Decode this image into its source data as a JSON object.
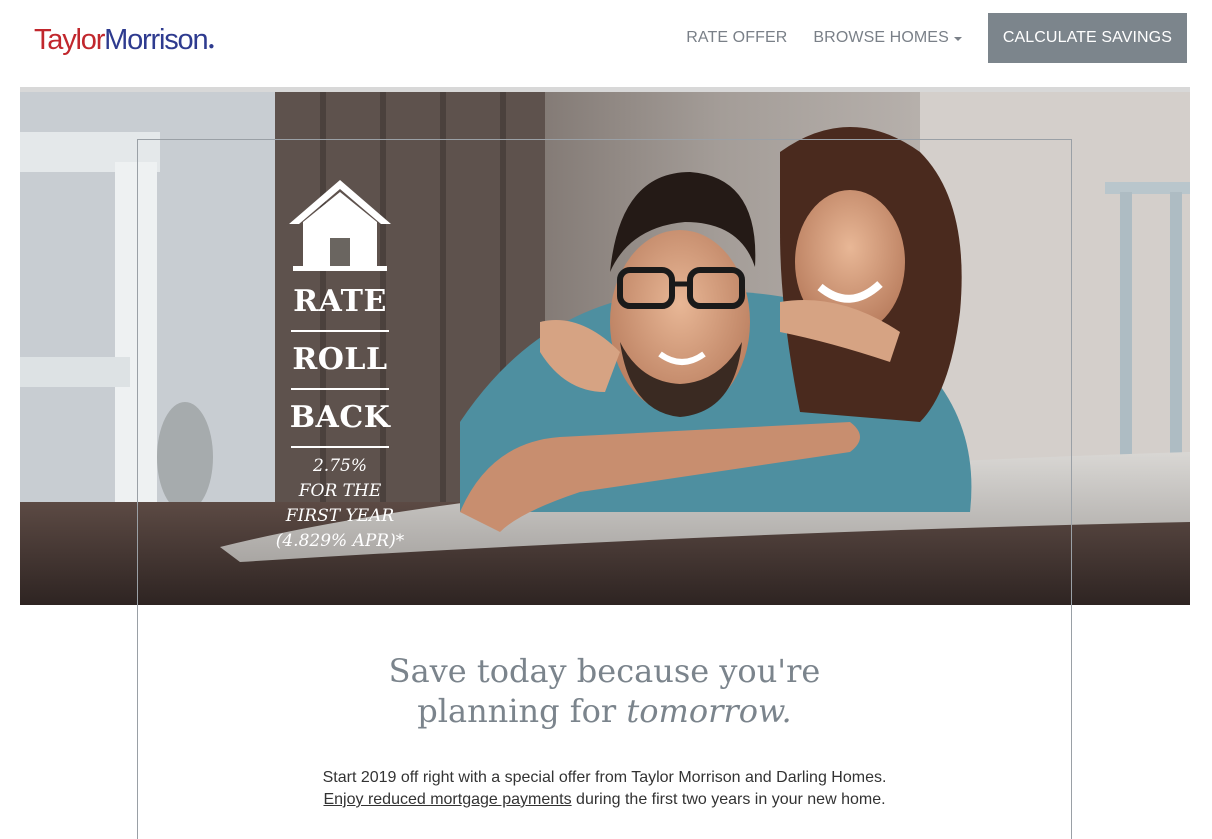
{
  "header": {
    "logo_taylor": "Taylor",
    "logo_morrison": "Morrison",
    "logo_dot": "●",
    "nav": {
      "rate_offer": "RATE OFFER",
      "browse_homes": "BROWSE HOMES",
      "calculate_savings": "CALCULATE SAVINGS"
    }
  },
  "hero": {
    "badge": {
      "line1": "RATE",
      "line2": "ROLL",
      "line3": "BACK",
      "rate": "2.75%",
      "period_1": "FOR THE",
      "period_2": "FIRST YEAR",
      "apr": "(4.829% APR)*"
    },
    "photo": "couple-lying-on-rug-photo"
  },
  "content": {
    "headline_line1": "Save today because you're",
    "headline_line2_plain": "planning for ",
    "headline_line2_italic": "tomorrow.",
    "intro_line1": "Start 2019 off right with a special offer from Taylor Morrison and Darling Homes.",
    "intro_link": "Enjoy reduced mortgage payments",
    "intro_line2_rest": " during the first two years in your new home."
  },
  "colors": {
    "brand_red": "#c1272d",
    "brand_blue": "#2e3b8f",
    "nav_gray": "#7a8088",
    "cta_bg": "#7c858c",
    "headline_gray": "#7b848c"
  },
  "icons": {
    "house": "house-icon",
    "dropdown": "caret-down-icon"
  }
}
